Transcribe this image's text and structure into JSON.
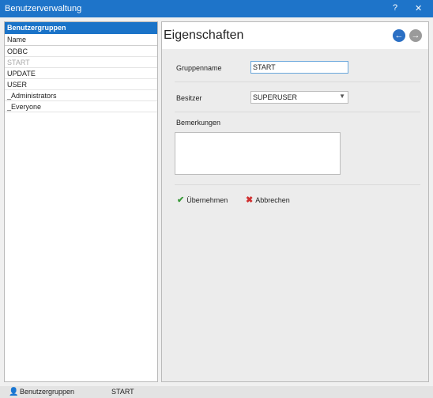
{
  "window": {
    "title": "Benutzerverwaltung",
    "help": "?",
    "close": "✕"
  },
  "left": {
    "header": "Benutzergruppen",
    "column": "Name",
    "items": [
      "ODBC",
      "START",
      "UPDATE",
      "USER",
      "_Administrators",
      "_Everyone"
    ]
  },
  "right": {
    "heading": "Eigenschaften",
    "back": "←",
    "forward": "→",
    "group_label": "Gruppenname",
    "group_value": "START",
    "owner_label": "Besitzer",
    "owner_value": "SUPERUSER",
    "notes_label": "Bemerkungen",
    "ok_label": "Übernehmen",
    "cancel_label": "Abbrechen",
    "ok_icon": "✔",
    "cancel_icon": "✖"
  },
  "status": {
    "icon": "👤",
    "section": "Benutzergruppen",
    "current": "START"
  }
}
